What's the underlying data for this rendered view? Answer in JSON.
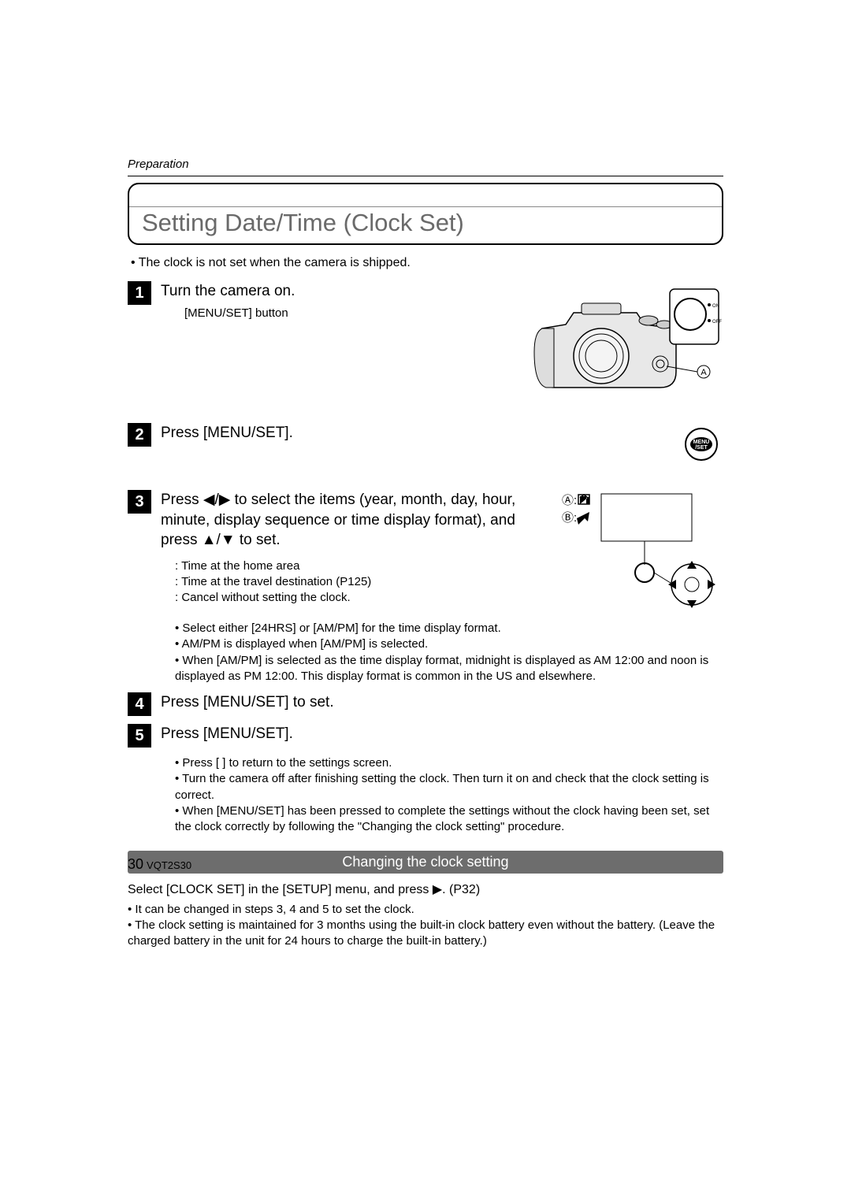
{
  "section": "Preparation",
  "title": "Setting Date/Time (Clock Set)",
  "intro": "• The clock is not set when the camera is shipped.",
  "steps": {
    "s1": {
      "num": "1",
      "title": "Turn the camera on.",
      "sub": "[MENU/SET] button",
      "label_A": "A",
      "switch_on": "ON",
      "switch_off": "OFF"
    },
    "s2": {
      "num": "2",
      "title": "Press [MENU/SET].",
      "icon_top": "MENU",
      "icon_bot": "/SET"
    },
    "s3": {
      "num": "3",
      "title": "Press ◀/▶ to select the items (year, month, day, hour, minute, display sequence or time display format), and press ▲/▼ to set.",
      "labelA": "Ⓐ:",
      "labelB": "Ⓑ:",
      "b1": ": Time at the home area",
      "b2": ": Time at the travel destination (P125)",
      "b3": ": Cancel without setting the clock.",
      "b4": "• Select either [24HRS] or [AM/PM] for the time display format.",
      "b5": "• AM/PM is displayed when [AM/PM] is selected.",
      "b6": "• When [AM/PM] is selected as the time display format, midnight is displayed as AM 12:00 and noon is displayed as PM 12:00. This display format is common in the US and elsewhere."
    },
    "s4": {
      "num": "4",
      "title": "Press [MENU/SET] to set."
    },
    "s5": {
      "num": "5",
      "title": "Press [MENU/SET].",
      "b1": "• Press [   ] to return to the settings screen.",
      "b2": "• Turn the camera off after finishing setting the clock. Then turn it on and check that the clock setting is correct.",
      "b3": "• When [MENU/SET] has been pressed to complete the settings without the clock having been set, set the clock correctly by following the \"Changing the clock setting\" procedure."
    }
  },
  "subheader": "Changing the clock setting",
  "footer": {
    "line1": "Select [CLOCK SET] in the [SETUP] menu, and press ▶. (P32)",
    "b1": "• It can be changed in steps 3, 4 and 5 to set the clock.",
    "b2": "• The clock setting is maintained for 3 months using the built-in clock battery even without the battery. (Leave the charged battery in the unit for 24 hours to charge the built-in battery.)"
  },
  "page": {
    "num": "30",
    "code": "VQT2S30"
  }
}
